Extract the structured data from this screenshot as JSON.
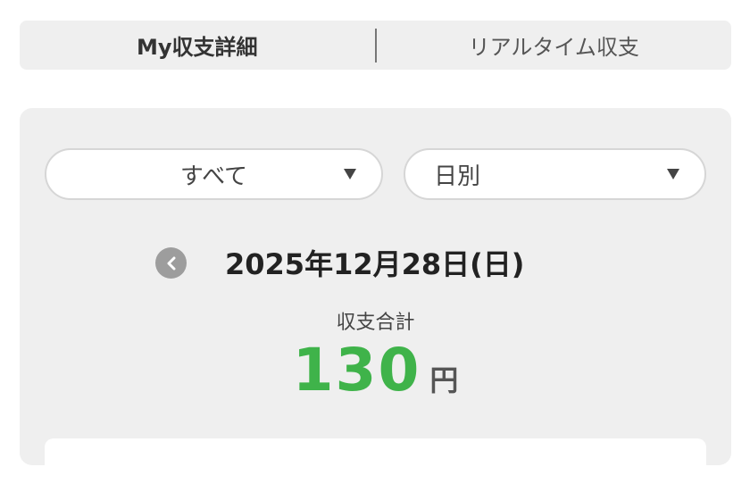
{
  "tabs": [
    {
      "label": "My収支詳細",
      "active": true
    },
    {
      "label": "リアルタイム収支",
      "active": false
    }
  ],
  "filters": {
    "category": {
      "selected": "すべて"
    },
    "period": {
      "selected": "日別"
    }
  },
  "date_nav": {
    "date": "2025年12月28日(日)",
    "prev_icon": "chevron-left-icon"
  },
  "summary": {
    "label": "収支合計",
    "value": "130",
    "unit": "円"
  },
  "colors": {
    "positive_value": "#3fb34a",
    "panel_bg": "#efefef",
    "prev_button_bg": "#9d9d9d"
  }
}
